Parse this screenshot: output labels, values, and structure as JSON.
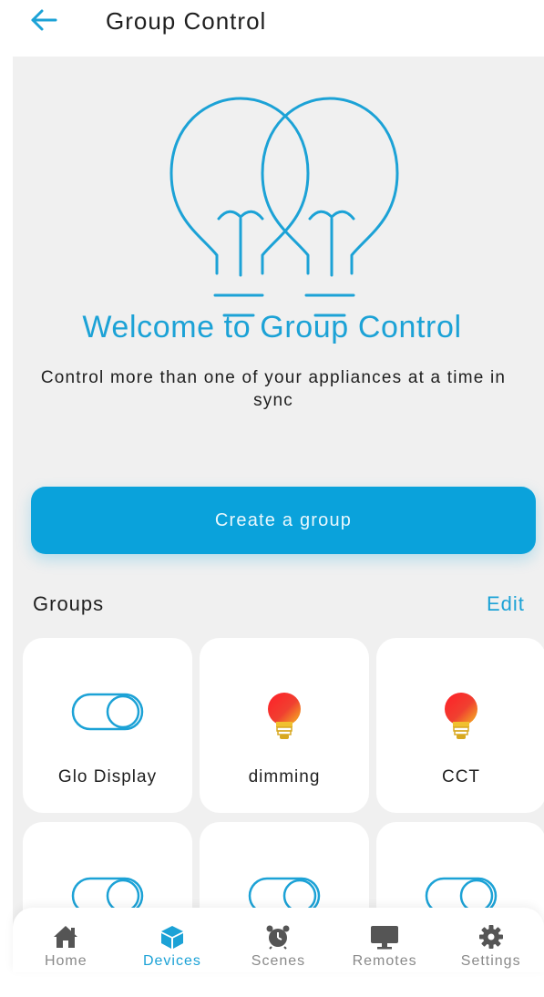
{
  "header": {
    "title": "Group Control",
    "back_icon": "arrow-left-icon"
  },
  "hero": {
    "illustration": "two-lightbulbs-icon",
    "welcome": "Welcome to Group Control",
    "subtitle": "Control more than one of your appliances at a time in sync"
  },
  "cta": {
    "label": "Create a group"
  },
  "groups": {
    "label": "Groups",
    "edit_label": "Edit",
    "cards": [
      {
        "label": "Glo Display",
        "icon": "toggle-icon"
      },
      {
        "label": "dimming",
        "icon": "lightbulb-icon"
      },
      {
        "label": "CCT",
        "icon": "lightbulb-icon"
      },
      {
        "label": "",
        "icon": "toggle-icon"
      },
      {
        "label": "",
        "icon": "toggle-icon"
      },
      {
        "label": "",
        "icon": "toggle-icon"
      }
    ]
  },
  "nav": {
    "items": [
      {
        "label": "Home",
        "icon": "home-icon",
        "active": false
      },
      {
        "label": "Devices",
        "icon": "cube-icon",
        "active": true
      },
      {
        "label": "Scenes",
        "icon": "alarm-clock-icon",
        "active": false
      },
      {
        "label": "Remotes",
        "icon": "monitor-icon",
        "active": false
      },
      {
        "label": "Settings",
        "icon": "gear-icon",
        "active": false
      }
    ]
  },
  "colors": {
    "accent": "#1ca2d6",
    "button": "#0aa2db",
    "background": "#f0f0f0"
  }
}
